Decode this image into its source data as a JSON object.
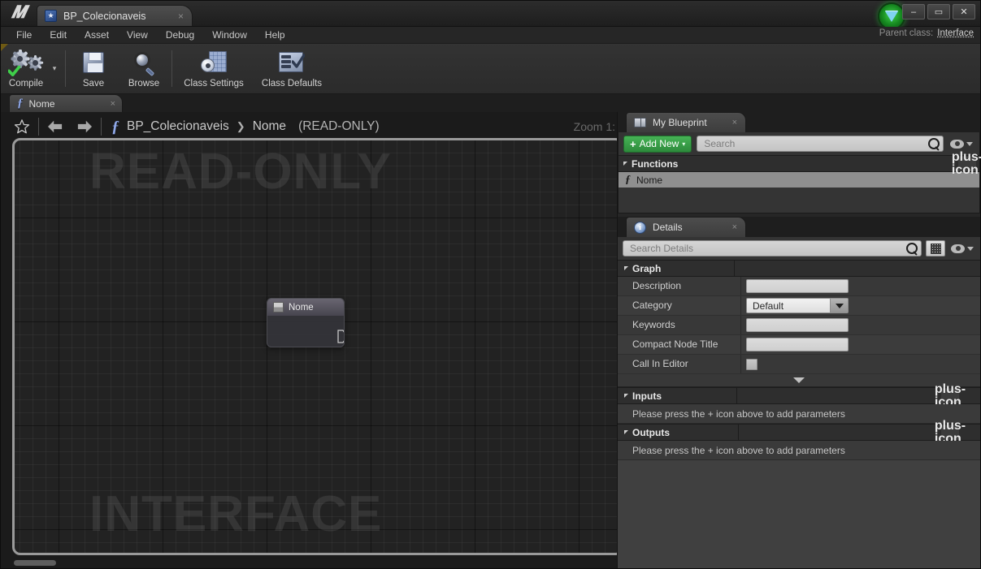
{
  "window": {
    "logo_icon": "unreal-logo",
    "asset_tab": {
      "label": "BP_Colecionaveis",
      "icon": "blueprint-icon",
      "close": "×"
    },
    "controls": {
      "minimize": "–",
      "maximize": "▭",
      "close": "✕"
    },
    "live_coding_icon": "live-coding-status-icon"
  },
  "menu": {
    "items": [
      "File",
      "Edit",
      "Asset",
      "View",
      "Debug",
      "Window",
      "Help"
    ],
    "parent_class_label": "Parent class:",
    "parent_class_value": "Interface"
  },
  "toolbar": {
    "compile": {
      "label": "Compile",
      "icon": "compile-gears-check-icon"
    },
    "compile_dropdown": "▾",
    "save": {
      "label": "Save",
      "icon": "floppy-disk-icon"
    },
    "browse": {
      "label": "Browse",
      "icon": "magnifier-icon"
    },
    "class_settings": {
      "label": "Class Settings",
      "icon": "gear-grid-icon"
    },
    "class_defaults": {
      "label": "Class Defaults",
      "icon": "checklist-icon"
    }
  },
  "document_tabs": [
    {
      "label": "Nome",
      "icon": "function-fx-icon",
      "close": "×",
      "active": true
    }
  ],
  "graph": {
    "favorite_icon": "star-icon",
    "back_icon": "arrow-left-icon",
    "forward_icon": "arrow-right-icon",
    "function_icon": "function-fx-icon",
    "breadcrumb": {
      "root": "BP_Colecionaveis",
      "separator": "❯",
      "current": "Nome",
      "status": "(READ-ONLY)"
    },
    "zoom_label": "Zoom 1:",
    "watermark_top": "READ-ONLY",
    "watermark_bottom": "INTERFACE",
    "node": {
      "title": "Nome",
      "icon": "function-entry-icon",
      "exec_out_pin": "exec-output-pin"
    }
  },
  "my_blueprint": {
    "tab": {
      "label": "My Blueprint",
      "icon": "book-icon",
      "close": "×"
    },
    "add_new": {
      "label": "Add New",
      "plus": "+",
      "caret": "▾"
    },
    "search": {
      "value": "",
      "placeholder": "Search",
      "icon": "search-icon"
    },
    "visibility_icon": "eye-icon",
    "sections": [
      {
        "name": "Functions",
        "add_icon": "plus-icon",
        "items": [
          {
            "label": "Nome",
            "icon": "function-fx-icon",
            "selected": true
          }
        ]
      }
    ]
  },
  "details": {
    "tab": {
      "label": "Details",
      "icon": "info-icon",
      "close": "×"
    },
    "search": {
      "value": "",
      "placeholder": "Search Details",
      "icon": "search-icon"
    },
    "grid_view_icon": "grid-view-icon",
    "visibility_icon": "eye-icon",
    "graph_section": {
      "title": "Graph",
      "rows": [
        {
          "name": "Description",
          "type": "text",
          "value": ""
        },
        {
          "name": "Category",
          "type": "combo",
          "value": "Default"
        },
        {
          "name": "Keywords",
          "type": "text",
          "value": ""
        },
        {
          "name": "Compact Node Title",
          "type": "text",
          "value": ""
        },
        {
          "name": "Call In Editor",
          "type": "checkbox",
          "value": ""
        }
      ],
      "expand_icon": "expand-more-icon"
    },
    "inputs_section": {
      "title": "Inputs",
      "add_icon": "plus-icon",
      "hint": "Please press the + icon above to add parameters"
    },
    "outputs_section": {
      "title": "Outputs",
      "add_icon": "plus-icon",
      "hint": "Please press the + icon above to add parameters"
    }
  },
  "colors": {
    "accent_green": "#2d8b3c",
    "panel_bg": "#404040",
    "graph_bg": "#222222",
    "selection": "#8f8f8f"
  }
}
